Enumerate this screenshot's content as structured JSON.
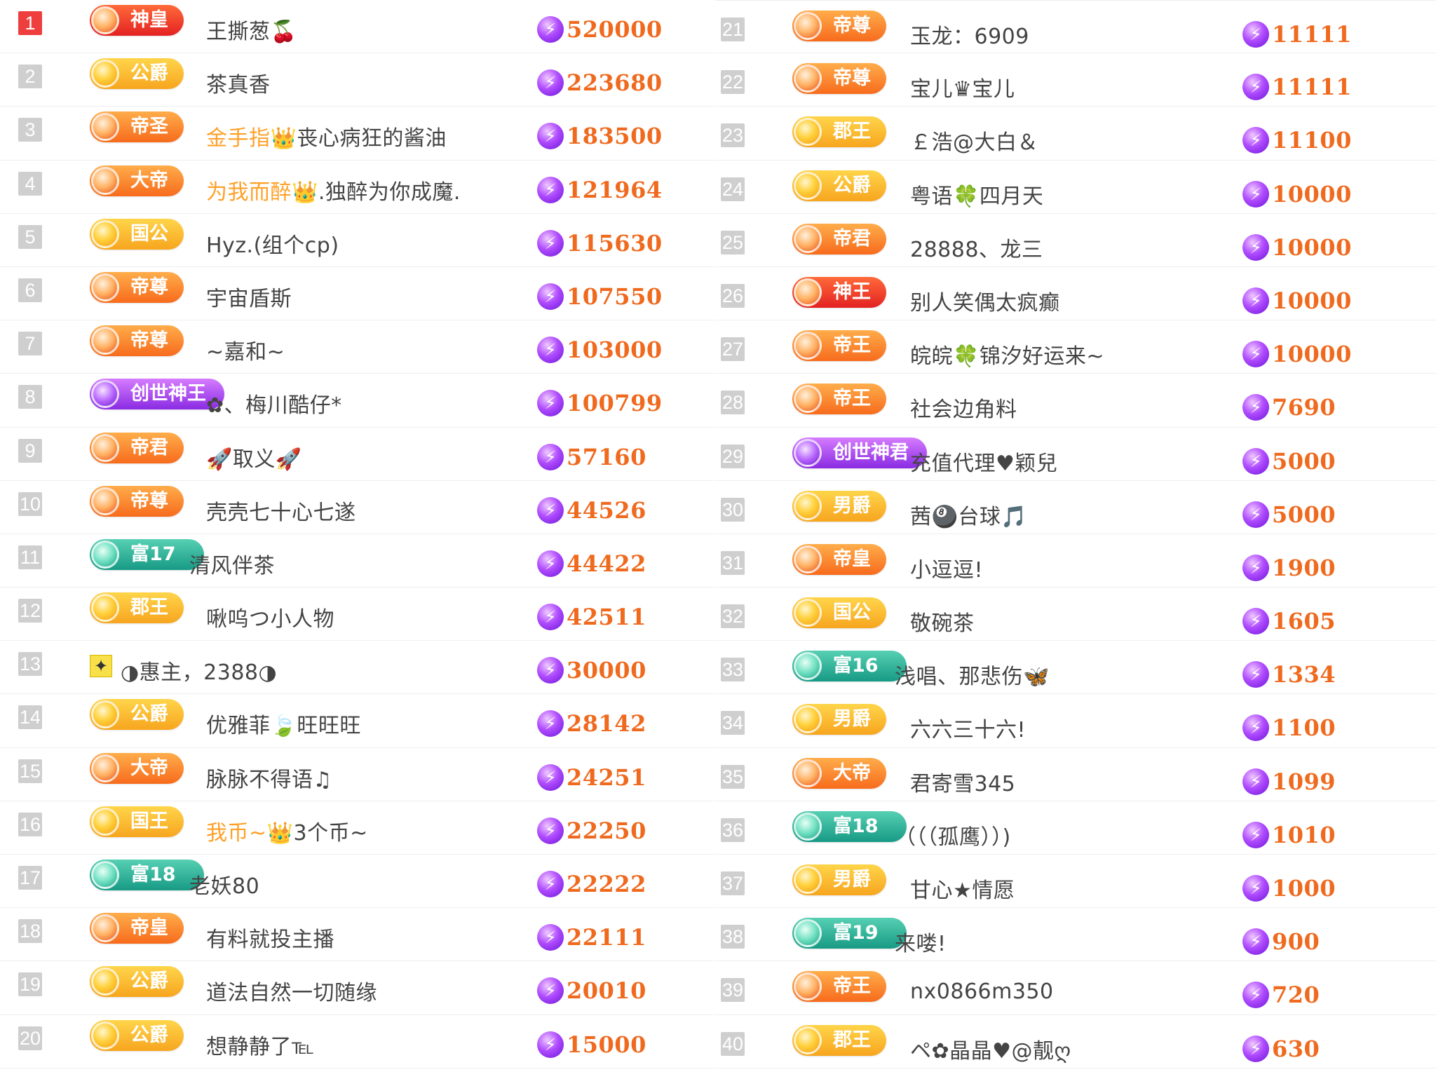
{
  "colors": {
    "rank_top": "#ef3e3e",
    "rank_normal": "#cfcfcf",
    "score_text": "#ef6a1e",
    "highlight_name": "#ffa028"
  },
  "left_rows": [
    {
      "rank": "1",
      "badge": "神皇",
      "tier": "red",
      "name": "王撕葱🍒",
      "score": "520000"
    },
    {
      "rank": "2",
      "badge": "公爵",
      "tier": "gold",
      "name": "茶真香",
      "score": "223680"
    },
    {
      "rank": "3",
      "badge": "帝圣",
      "tier": "orange",
      "name_hl": "金手指👑",
      "name": "丧心病狂的酱油",
      "score": "183500"
    },
    {
      "rank": "4",
      "badge": "大帝",
      "tier": "orange",
      "name_hl": "为我而醉👑",
      "name": ".独醉为你成魔.",
      "score": "121964"
    },
    {
      "rank": "5",
      "badge": "国公",
      "tier": "gold",
      "name": "Hyz.(组个cp)",
      "score": "115630"
    },
    {
      "rank": "6",
      "badge": "帝尊",
      "tier": "orange",
      "name": "宇宙盾斯",
      "score": "107550"
    },
    {
      "rank": "7",
      "badge": "帝尊",
      "tier": "orange",
      "name": "~嘉和~",
      "score": "103000"
    },
    {
      "rank": "8",
      "badge": "创世神王",
      "tier": "purple",
      "name": "✿、梅川酷仔*",
      "score": "100799"
    },
    {
      "rank": "9",
      "badge": "帝君",
      "tier": "orange",
      "name": "🚀取义🚀",
      "score": "57160"
    },
    {
      "rank": "10",
      "badge": "帝尊",
      "tier": "orange",
      "name": "壳壳七十心七遂",
      "score": "44526"
    },
    {
      "rank": "11",
      "badge": "富17",
      "tier": "teal",
      "name": "清风伴茶",
      "score": "44422"
    },
    {
      "rank": "12",
      "badge": "郡王",
      "tier": "gold",
      "name": "啾呜つ小人物",
      "score": "42511"
    },
    {
      "rank": "13",
      "badge": "",
      "tier": "plain",
      "name": "◑惠主，2388◑",
      "score": "30000"
    },
    {
      "rank": "14",
      "badge": "公爵",
      "tier": "gold",
      "name": "优雅菲🍃旺旺旺",
      "score": "28142"
    },
    {
      "rank": "15",
      "badge": "大帝",
      "tier": "orange",
      "name": "脉脉不得语♫",
      "score": "24251"
    },
    {
      "rank": "16",
      "badge": "国王",
      "tier": "gold",
      "name_hl": "我币~👑",
      "name": "3个币~",
      "score": "22250"
    },
    {
      "rank": "17",
      "badge": "富18",
      "tier": "teal",
      "name": "老妖80",
      "score": "22222"
    },
    {
      "rank": "18",
      "badge": "帝皇",
      "tier": "orange",
      "name": "有料就投主播",
      "score": "22111"
    },
    {
      "rank": "19",
      "badge": "公爵",
      "tier": "gold",
      "name": "道法自然一切随缘",
      "score": "20010"
    },
    {
      "rank": "20",
      "badge": "公爵",
      "tier": "gold",
      "name": "想静静了℡",
      "score": "15000"
    }
  ],
  "right_rows": [
    {
      "rank": "21",
      "badge": "帝尊",
      "tier": "orange",
      "name": "玉龙：6909",
      "score": "11111"
    },
    {
      "rank": "22",
      "badge": "帝尊",
      "tier": "orange",
      "name": "宝儿♛宝儿",
      "score": "11111"
    },
    {
      "rank": "23",
      "badge": "郡王",
      "tier": "gold",
      "name": "￡浩@大白＆",
      "score": "11100"
    },
    {
      "rank": "24",
      "badge": "公爵",
      "tier": "gold",
      "name": "粤语🍀四月天",
      "score": "10000"
    },
    {
      "rank": "25",
      "badge": "帝君",
      "tier": "orange",
      "name": "28888、龙三",
      "score": "10000"
    },
    {
      "rank": "26",
      "badge": "神王",
      "tier": "red",
      "name": "别人笑偶太疯癫",
      "score": "10000"
    },
    {
      "rank": "27",
      "badge": "帝王",
      "tier": "orange",
      "name": "皖皖🍀锦汐好运来~",
      "score": "10000"
    },
    {
      "rank": "28",
      "badge": "帝王",
      "tier": "orange",
      "name": "社会边角料",
      "score": "7690"
    },
    {
      "rank": "29",
      "badge": "创世神君",
      "tier": "purple",
      "name": "充值代理♥颖兒",
      "score": "5000"
    },
    {
      "rank": "30",
      "badge": "男爵",
      "tier": "gold",
      "name": "茜🎱台球🎵",
      "score": "5000"
    },
    {
      "rank": "31",
      "badge": "帝皇",
      "tier": "orange",
      "name": "小逗逗!",
      "score": "1900"
    },
    {
      "rank": "32",
      "badge": "国公",
      "tier": "gold",
      "name": "敬碗茶",
      "score": "1605"
    },
    {
      "rank": "33",
      "badge": "富16",
      "tier": "teal",
      "name": "浅唱、那悲伤🦋",
      "score": "1334"
    },
    {
      "rank": "34",
      "badge": "男爵",
      "tier": "gold",
      "name": "六六三十六!",
      "score": "1100"
    },
    {
      "rank": "35",
      "badge": "大帝",
      "tier": "orange",
      "name": "君寄雪345",
      "score": "1099"
    },
    {
      "rank": "36",
      "badge": "富18",
      "tier": "teal",
      "name": "（（（孤鹰））)",
      "score": "1010"
    },
    {
      "rank": "37",
      "badge": "男爵",
      "tier": "gold",
      "name": "甘心★情愿",
      "score": "1000"
    },
    {
      "rank": "38",
      "badge": "富19",
      "tier": "teal",
      "name": "来喽!",
      "score": "900"
    },
    {
      "rank": "39",
      "badge": "帝王",
      "tier": "orange",
      "name": "nx0866m350",
      "score": "720"
    },
    {
      "rank": "40",
      "badge": "郡王",
      "tier": "gold",
      "name": "ペ✿晶晶♥@靓ღ",
      "score": "630"
    }
  ]
}
